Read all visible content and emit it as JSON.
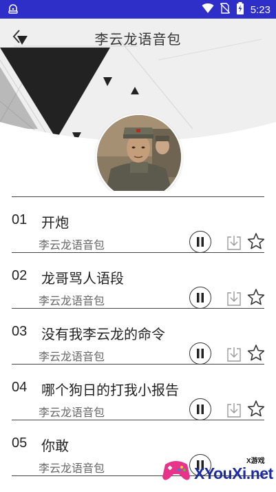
{
  "status_bar": {
    "time": "5:23",
    "icons": [
      "notification-icon",
      "wifi-icon",
      "no-sim-icon",
      "battery-charging-icon"
    ],
    "background": "#2e2ec9"
  },
  "header": {
    "title": "李云龙语音包",
    "back_icon": "back-chevron-icon"
  },
  "tracks": [
    {
      "num": "01",
      "name": "开炮",
      "sub": "李云龙语音包"
    },
    {
      "num": "02",
      "name": "龙哥骂人语段",
      "sub": "李云龙语音包"
    },
    {
      "num": "03",
      "name": "没有我李云龙的命令",
      "sub": "李云龙语音包"
    },
    {
      "num": "04",
      "name": "哪个狗日的打我小报告",
      "sub": "李云龙语音包"
    },
    {
      "num": "05",
      "name": "你敢",
      "sub": "李云龙语音包"
    }
  ],
  "watermark": {
    "small_text": "X游戏",
    "big_text": "XYouXi.net"
  }
}
